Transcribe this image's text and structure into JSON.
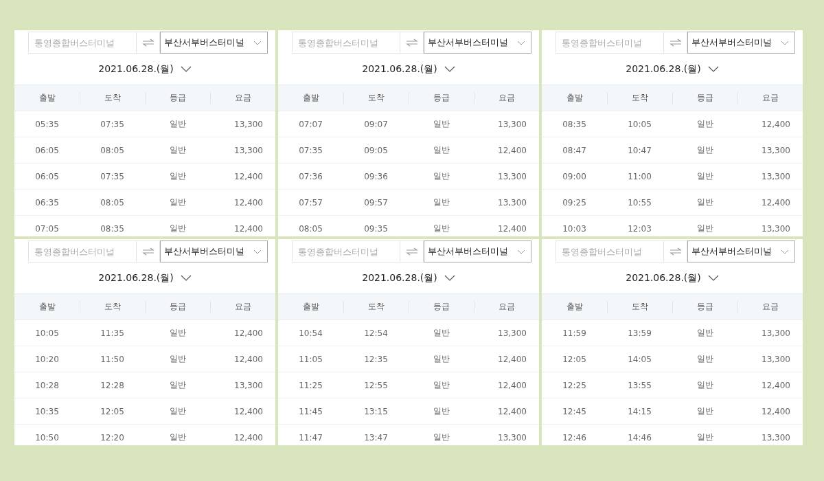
{
  "panels": [
    {
      "origin": {
        "placeholder": "통영종합버스터미널"
      },
      "destination": "부산서부버스터미널",
      "date": "2021.06.28.(월)",
      "columns": [
        "출발",
        "도착",
        "등급",
        "요금"
      ],
      "rows": [
        [
          "05:35",
          "07:35",
          "일반",
          "13,300"
        ],
        [
          "06:05",
          "08:05",
          "일반",
          "13,300"
        ],
        [
          "06:05",
          "07:35",
          "일반",
          "12,400"
        ],
        [
          "06:35",
          "08:05",
          "일반",
          "12,400"
        ],
        [
          "07:05",
          "08:35",
          "일반",
          "12,400"
        ]
      ]
    },
    {
      "origin": {
        "placeholder": "통영종합버스터미널"
      },
      "destination": "부산서부버스터미널",
      "date": "2021.06.28.(월)",
      "columns": [
        "출발",
        "도착",
        "등급",
        "요금"
      ],
      "rows": [
        [
          "07:07",
          "09:07",
          "일반",
          "13,300"
        ],
        [
          "07:35",
          "09:05",
          "일반",
          "12,400"
        ],
        [
          "07:36",
          "09:36",
          "일반",
          "13,300"
        ],
        [
          "07:57",
          "09:57",
          "일반",
          "13,300"
        ],
        [
          "08:05",
          "09:35",
          "일반",
          "12,400"
        ]
      ]
    },
    {
      "origin": {
        "placeholder": "통영종합버스터미널"
      },
      "destination": "부산서부버스터미널",
      "date": "2021.06.28.(월)",
      "columns": [
        "출발",
        "도착",
        "등급",
        "요금"
      ],
      "rows": [
        [
          "08:35",
          "10:05",
          "일반",
          "12,400"
        ],
        [
          "08:47",
          "10:47",
          "일반",
          "13,300"
        ],
        [
          "09:00",
          "11:00",
          "일반",
          "13,300"
        ],
        [
          "09:25",
          "10:55",
          "일반",
          "12,400"
        ],
        [
          "10:03",
          "12:03",
          "일반",
          "13,300"
        ]
      ]
    },
    {
      "origin": {
        "placeholder": "통영종합버스터미널"
      },
      "destination": "부산서부버스터미널",
      "date": "2021.06.28.(월)",
      "columns": [
        "출발",
        "도착",
        "등급",
        "요금"
      ],
      "rows": [
        [
          "10:05",
          "11:35",
          "일반",
          "12,400"
        ],
        [
          "10:20",
          "11:50",
          "일반",
          "12,400"
        ],
        [
          "10:28",
          "12:28",
          "일반",
          "13,300"
        ],
        [
          "10:35",
          "12:05",
          "일반",
          "12,400"
        ],
        [
          "10:50",
          "12:20",
          "일반",
          "12,400"
        ]
      ]
    },
    {
      "origin": {
        "placeholder": "통영종합버스터미널"
      },
      "destination": "부산서부버스터미널",
      "date": "2021.06.28.(월)",
      "columns": [
        "출발",
        "도착",
        "등급",
        "요금"
      ],
      "rows": [
        [
          "10:54",
          "12:54",
          "일반",
          "13,300"
        ],
        [
          "11:05",
          "12:35",
          "일반",
          "12,400"
        ],
        [
          "11:25",
          "12:55",
          "일반",
          "12,400"
        ],
        [
          "11:45",
          "13:15",
          "일반",
          "12,400"
        ],
        [
          "11:47",
          "13:47",
          "일반",
          "13,300"
        ]
      ]
    },
    {
      "origin": {
        "placeholder": "통영종합버스터미널"
      },
      "destination": "부산서부버스터미널",
      "date": "2021.06.28.(월)",
      "columns": [
        "출발",
        "도착",
        "등급",
        "요금"
      ],
      "rows": [
        [
          "11:59",
          "13:59",
          "일반",
          "13,300"
        ],
        [
          "12:05",
          "14:05",
          "일반",
          "13,300"
        ],
        [
          "12:25",
          "13:55",
          "일반",
          "12,400"
        ],
        [
          "12:45",
          "14:15",
          "일반",
          "12,400"
        ],
        [
          "12:46",
          "14:46",
          "일반",
          "13,300"
        ]
      ]
    }
  ]
}
